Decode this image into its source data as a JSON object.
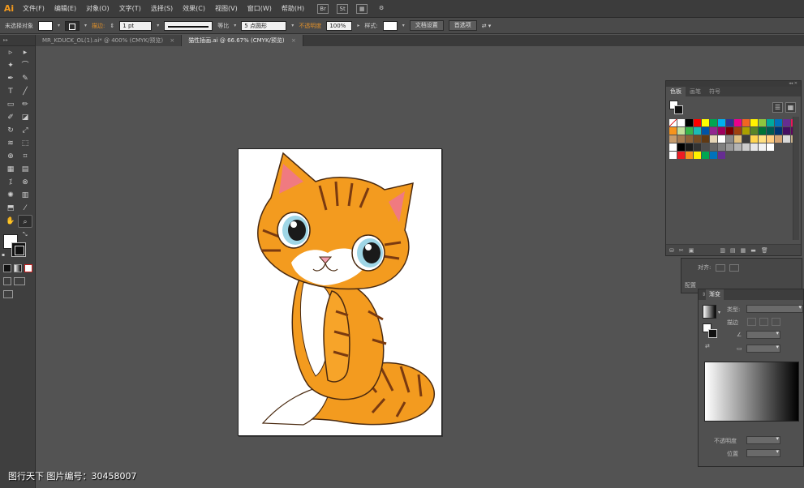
{
  "app": {
    "logo": "Ai"
  },
  "menu": [
    "文件(F)",
    "编辑(E)",
    "对象(O)",
    "文字(T)",
    "选择(S)",
    "效果(C)",
    "视图(V)",
    "窗口(W)",
    "帮助(H)"
  ],
  "menubar_icons": {
    "br": "Br",
    "st": "St"
  },
  "control": {
    "selection": "未选择对象",
    "stroke_label": "描边:",
    "stroke_weight": "1 pt",
    "profile": "等比",
    "brush": "5 点圆形",
    "opacity_label": "不透明度",
    "opacity_value": "100%",
    "style_label": "样式:",
    "doc_setup": "文档设置",
    "preferences": "首选项"
  },
  "tabs": [
    {
      "label": "MR_KDUCK_OL(1).ai* @ 400% (CMYK/预览)",
      "close": "×"
    },
    {
      "label": "猫性插画.ai @ 66.67% (CMYK/预览)",
      "close": "×"
    }
  ],
  "toolbar": {
    "rows": [
      [
        "selection-tool",
        "direct-selection-tool"
      ],
      [
        "magic-wand-tool",
        "lasso-tool"
      ],
      [
        "pen-tool",
        "curvature-tool"
      ],
      [
        "type-tool",
        "line-tool"
      ],
      [
        "rectangle-tool",
        "paintbrush-tool"
      ],
      [
        "pencil-tool",
        "eraser-tool"
      ],
      [
        "rotate-tool",
        "scale-tool"
      ],
      [
        "warp-tool",
        "free-transform-tool"
      ],
      [
        "shape-builder-tool",
        "perspective-tool"
      ],
      [
        "mesh-tool",
        "gradient-tool"
      ],
      [
        "eyedropper-tool",
        "blend-tool"
      ],
      [
        "symbol-sprayer-tool",
        "column-graph-tool"
      ],
      [
        "artboard-tool",
        "slice-tool"
      ],
      [
        "hand-tool",
        "zoom-tool"
      ]
    ],
    "glyphs": [
      "▹",
      "▸",
      "✦",
      "⌒",
      "✒",
      "✎",
      "T",
      "╱",
      "▭",
      "✏",
      "✐",
      "◪",
      "↻",
      "⤢",
      "≋",
      "⬚",
      "⊕",
      "⌗",
      "▦",
      "▤",
      "⁒",
      "⊗",
      "✺",
      "▥",
      "⬒",
      "⁄",
      "✋",
      "⌕"
    ]
  },
  "swatches_panel": {
    "tabs": [
      "色板",
      "画笔",
      "符号"
    ],
    "grip": "◂◂ ✕",
    "colors": [
      "#ffffff",
      "#ffffff",
      "#000000",
      "#ff0000",
      "#ffff00",
      "#00a651",
      "#00aeef",
      "#2e3192",
      "#ec008c",
      "#f26522",
      "#fff200",
      "#8dc63f",
      "#00a99d",
      "#0072bc",
      "#662d91",
      "#ed145b",
      "#f7941d",
      "#c4df9b",
      "#39b54a",
      "#1cbbb4",
      "#0054a6",
      "#92278f",
      "#9e005d",
      "#790000",
      "#a0410d",
      "#aba000",
      "#598527",
      "#007236",
      "#005952",
      "#003471",
      "#440e62",
      "#630460",
      "#c69c6d",
      "#a67c52",
      "#8c6239",
      "#754c24",
      "#603913",
      "#e6d6b8",
      "#ffffff",
      "#8a8a8a",
      "#e0c080",
      "#3c3c3c",
      "#ffd54f",
      "#ffe082",
      "#ffcc80",
      "#d4a373",
      "#d9d9d9",
      "#c8b08a",
      "#ffffff",
      "#000000",
      "#1a1a1a",
      "#333333",
      "#4d4d4d",
      "#666666",
      "#808080",
      "#999999",
      "#b3b3b3",
      "#cccccc",
      "#e6e6e6",
      "#f2f2f2",
      "#ffffff",
      "#505050",
      "#505050",
      "#505050",
      "#ffffff",
      "#ed1c24",
      "#f7941d",
      "#fff200",
      "#00a651",
      "#0072bc",
      "#662d91",
      "#505050"
    ],
    "bottom_icons": [
      "⛁",
      "✂",
      "▣",
      "▥",
      "▤",
      "▦",
      "▬",
      "🗑"
    ]
  },
  "align_panel": {
    "label1": "对齐:",
    "label2": "配置"
  },
  "gradient_panel": {
    "title": "渐变",
    "type_label": "类型:",
    "stroke_label": "描边",
    "opacity_label": "不透明度",
    "location_label": "位置"
  },
  "watermark": "图行天下  图片编号：30458007",
  "canvas": {
    "background": "#535353",
    "artboard": "#ffffff"
  }
}
